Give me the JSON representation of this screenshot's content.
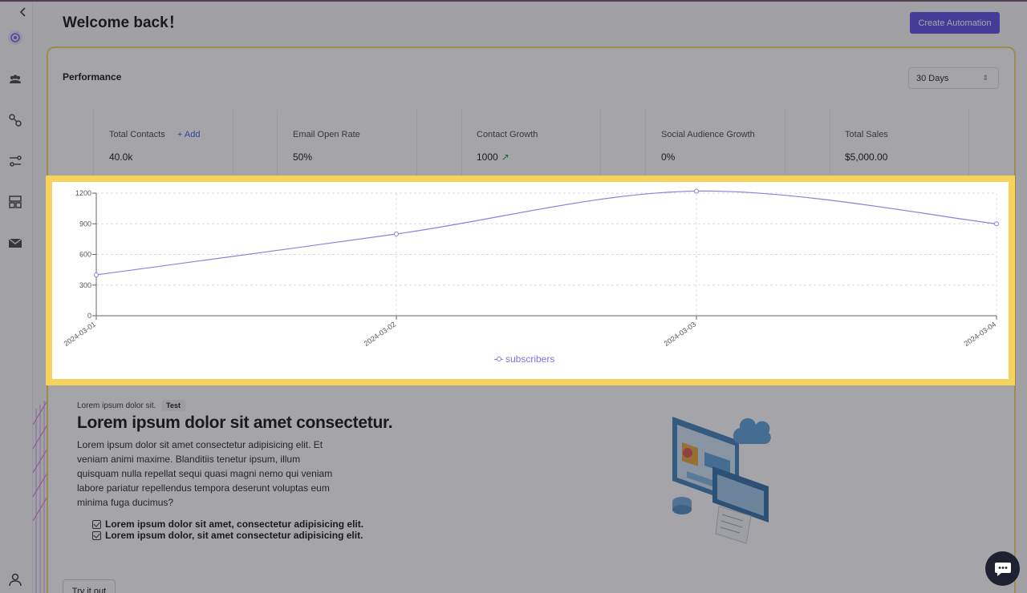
{
  "header": {
    "title": "Welcome back！",
    "create_button": "Create Automation"
  },
  "performance": {
    "title": "Performance",
    "range_select": "30 Days"
  },
  "stats": [
    {
      "label": "Total Contacts",
      "value": "40.0k",
      "action": "+ Add"
    },
    {
      "label": "Email Open Rate",
      "value": "50%"
    },
    {
      "label": "Contact Growth",
      "value": "1000",
      "trend_icon": "arrow-up-right-icon"
    },
    {
      "label": "Social Audience Growth",
      "value": "0%"
    },
    {
      "label": "Total Sales",
      "value": "$5,000.00"
    }
  ],
  "chart_data": {
    "type": "line",
    "x": [
      "2024-03-01",
      "2024-03-02",
      "2024-03-03",
      "2024-03-04"
    ],
    "series": [
      {
        "name": "subscribers",
        "values": [
          400,
          800,
          1220,
          900
        ]
      }
    ],
    "yticks": [
      "0",
      "300",
      "600",
      "900",
      "1200"
    ],
    "ylim": [
      0,
      1200
    ],
    "grid": true,
    "legend": "bottom-center",
    "line_color": "#8a80e0"
  },
  "promo": {
    "tagline": "Lorem ipsum dolor sit.",
    "badge": "Test",
    "heading": "Lorem ipsum dolor sit amet consectetur.",
    "body": "Lorem ipsum dolor sit amet consectetur adipisicing elit. Et veniam animi maxime. Blanditiis tenetur ipsum, illum quisquam nulla repellat sequi quasi magni nemo qui veniam labore pariatur repellendus tempora deserunt voluptas eum minima fuga ducimus?",
    "checklist": [
      "Lorem ipsum dolor sit amet, consectetur adipisicing elit.",
      "Lorem ipsum dolor, sit amet consectetur adipisicing elit."
    ],
    "try_button": "Try it out"
  },
  "sidebar": {
    "icons": [
      "collapse-chevron-icon",
      "brand-logo-icon",
      "contacts-icon",
      "flows-icon",
      "automations-icon",
      "templates-icon",
      "email-icon",
      "profile-icon"
    ]
  },
  "colors": {
    "accent": "#5b4be0",
    "highlight_border": "#f6d45c",
    "chart_line": "#8a80e0"
  }
}
